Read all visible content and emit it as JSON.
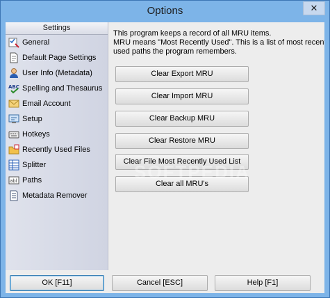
{
  "window": {
    "title": "Options",
    "close_glyph": "✕"
  },
  "sidebar": {
    "header": "Settings",
    "items": [
      {
        "label": "General",
        "icon": "checklist-icon",
        "color": "#2e6fc4"
      },
      {
        "label": "Default Page Settings",
        "icon": "page-icon",
        "color": "#4a4a4a"
      },
      {
        "label": "User Info (Metadata)",
        "icon": "user-icon",
        "color": "#2a5db0"
      },
      {
        "label": "Spelling and Thesaurus",
        "icon": "spellcheck-icon",
        "color": "#1f3d8a"
      },
      {
        "label": "Email Account",
        "icon": "envelope-icon",
        "color": "#c99a2e"
      },
      {
        "label": "Setup",
        "icon": "setup-icon",
        "color": "#3a6ea5"
      },
      {
        "label": "Hotkeys",
        "icon": "keyboard-icon",
        "color": "#555555"
      },
      {
        "label": "Recently Used Files",
        "icon": "folder-icon",
        "color": "#e0a82e"
      },
      {
        "label": "Splitter",
        "icon": "grid-icon",
        "color": "#2b62b8"
      },
      {
        "label": "Paths",
        "icon": "path-icon",
        "color": "#333333"
      },
      {
        "label": "Metadata Remover",
        "icon": "document-icon",
        "color": "#4a5a7a"
      }
    ]
  },
  "main": {
    "desc_line1": "This program keeps a record of all MRU items.",
    "desc_line2": "MRU means \"Most Recently Used\". This is a list of most recently",
    "desc_line3": "used paths the program remembers.",
    "buttons": [
      "Clear Export MRU",
      "Clear Import MRU",
      "Clear Backup MRU",
      "Clear Restore MRU",
      "Clear File Most Recently Used List",
      "Clear all MRU's"
    ]
  },
  "footer": {
    "ok": "OK [F11]",
    "cancel": "Cancel [ESC]",
    "help": "Help [F1]"
  },
  "watermark": "SOFTPEDIA"
}
